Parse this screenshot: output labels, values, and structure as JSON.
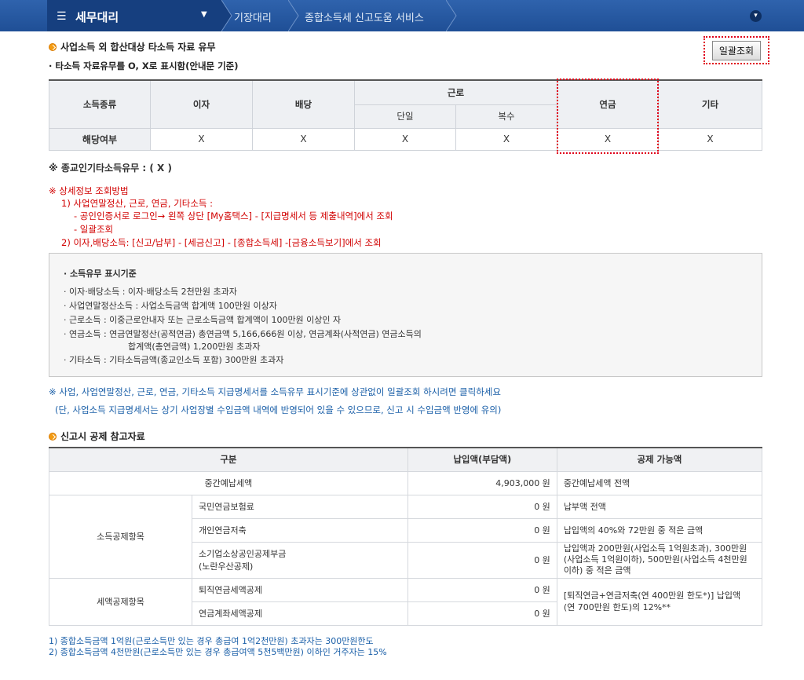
{
  "nav": {
    "app_title": "세무대리",
    "crumbs": [
      "기장대리",
      "종합소득세 신고도움 서비스"
    ]
  },
  "section1": {
    "title": "사업소득 외 합산대상 타소득 자료 유무",
    "subtitle": "타소득 자료유무를 O, X로 표시함(안내문 기준)",
    "bulk_button": "일괄조회"
  },
  "income_table": {
    "headers": {
      "type": "소득종류",
      "interest": "이자",
      "dividend": "배당",
      "labor": "근로",
      "labor_single": "단일",
      "labor_multi": "복수",
      "pension": "연금",
      "other": "기타"
    },
    "row_label": "해당여부",
    "values": [
      "X",
      "X",
      "X",
      "X",
      "X",
      "X"
    ]
  },
  "religious_note": "※ 종교인기타소득유무 : ( X )",
  "detail_lookup": {
    "heading": "※  상세정보 조회방법",
    "step1": "1) 사업연말정산, 근로, 연금, 기타소득 :",
    "step1a": "- 공인인증서로 로그인→ 왼쪽 상단 [My홈택스] - [지급명세서 등 제출내역]에서 조회",
    "step1b": "- 일괄조회",
    "step2": "2) 이자,배당소득: [신고/납부] - [세금신고] - [종합소득세] -[금융소득보기]에서 조회"
  },
  "criteria": {
    "title": "소득유무 표시기준",
    "items": [
      "이자·배당소득 : 이자·배당소득 2천만원 초과자",
      "사업연말정산소득 : 사업소득금액 합계액 100만원 이상자",
      "근로소득 : 이중근로안내자 또는 근로소득금액 합계액이 100만원 이상인 자",
      "연금소득 : 연금연말정산(공적연금) 총연금액 5,166,666원 이상, 연금계좌(사적연금) 연금소득의",
      "합계액(총연금액) 1,200만원 초과자",
      "기타소득 : 기타소득금액(종교인소득 포함) 300만원 초과자"
    ]
  },
  "bulk_note": {
    "line1": "※ 사업, 사업연말정산, 근로, 연금, 기타소득 지급명세서를 소득유무 표시기준에 상관없이 일괄조회 하시려면 클릭하세요",
    "line2": "(단, 사업소득 지급명세서는 상기 사업장별 수입금액 내역에 반영되어 있을 수 있으므로, 신고 시 수입금액 반영에 유의)"
  },
  "section2": {
    "title": "신고시 공제 참고자료"
  },
  "deduction_table": {
    "headers": [
      "구분",
      "납입액(부담액)",
      "공제 가능액"
    ],
    "interim": {
      "label": "중간예납세액",
      "amount": "4,903,000 원",
      "desc": "중간예납세액 전액"
    },
    "income_group": "소득공제항목",
    "income_rows": [
      {
        "label": "국민연금보험료",
        "amount": "0 원",
        "desc": "납부액 전액"
      },
      {
        "label": "개인연금저축",
        "amount": "0 원",
        "desc": "납입액의 40%와 72만원 중 적은 금액"
      },
      {
        "label": "소기업소상공인공제부금",
        "label2": "(노란우산공제)",
        "amount": "0 원",
        "desc": "납입액과 200만원(사업소득 1억원초과), 300만원",
        "desc2": "(사업소득 1억원이하), 500만원(사업소득 4천만원",
        "desc3": "이하) 중 적은 금액"
      }
    ],
    "tax_group": "세액공제항목",
    "tax_rows": [
      {
        "label": "퇴직연금세액공제",
        "amount": "0 원"
      },
      {
        "label": "연금계좌세액공제",
        "amount": "0 원"
      }
    ],
    "tax_desc": "[퇴직연금+연금저축(연 400만원 한도*)] 납입액",
    "tax_desc2": "(연 700만원 한도)의 12%**"
  },
  "footnotes": [
    "1)  종합소득금액 1억원(근로소득만 있는 경우 총급여 1억2천만원) 초과자는 300만원한도",
    "2)  종합소득금액 4천만원(근로소득만 있는 경우 총급여액 5천5백만원) 이하인 거주자는 15%"
  ]
}
